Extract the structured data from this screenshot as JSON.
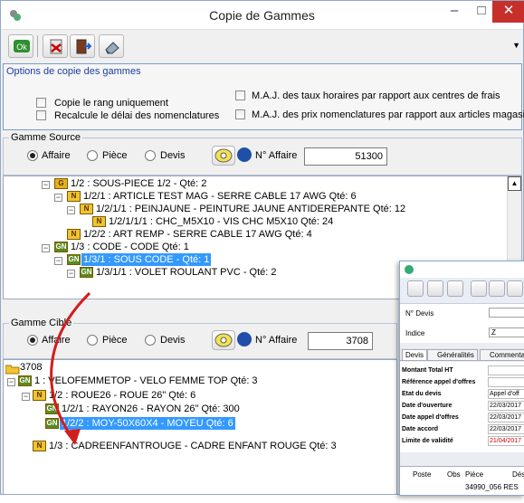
{
  "window": {
    "title": "Copie de Gammes",
    "minimize_glyph": "–",
    "maximize_glyph": "□",
    "close_glyph": "✕",
    "close_color": "#c7302a"
  },
  "toolbar": {
    "ok_label": "Ok",
    "icons": [
      "ok-icon",
      "cancel-icon",
      "exit-door-icon",
      "eraser-icon"
    ]
  },
  "options": {
    "title": "Options de copie des gammes",
    "copy_rank_label": "Copie le rang uniquement",
    "recalc_label": "Recalcule le délai des nomenclatures",
    "maj_taux_label": "M.A.J. des taux horaires par rapport aux centres de frais",
    "maj_prix_label": "M.A.J. des prix nomenclatures par rapport aux articles magasins"
  },
  "source": {
    "title": "Gamme Source",
    "radio_affaire": "Affaire",
    "radio_piece": "Pièce",
    "radio_devis": "Devis",
    "naffaire_label": "N° Affaire",
    "naffaire_value": "51300",
    "tree": [
      {
        "icon": "G",
        "text": "1/2 : SOUS-PIECE 1/2 - Qté: 2"
      },
      {
        "icon": "N",
        "text": "1/2/1 : ARTICLE TEST MAG - SERRE CABLE 17 AWG Qté: 6"
      },
      {
        "icon": "N",
        "text": "1/2/1/1 : PEINJAUNE - PEINTURE JAUNE ANTIDEREPANTE Qté: 12"
      },
      {
        "icon": "N",
        "text": "1/2/1/1/1 : CHC_M5X10 - VIS CHC M5X10 Qté: 24"
      },
      {
        "icon": "N",
        "text": "1/2/2 : ART REMP - SERRE CABLE 17 AWG Qté: 4"
      },
      {
        "icon": "GN",
        "text": "1/3 : CODE - CODE Qté: 1"
      },
      {
        "icon": "GN",
        "text": "1/3/1 : SOUS CODE - Qté: 1"
      },
      {
        "icon": "GN",
        "text": "1/3/1/1 : VOLET ROULANT PVC - Qté: 2"
      }
    ]
  },
  "cible": {
    "title": "Gamme Cible",
    "radio_affaire": "Affaire",
    "radio_piece": "Pièce",
    "radio_devis": "Devis",
    "naffaire_label": "N° Affaire",
    "naffaire_value": "3708",
    "tree": [
      {
        "icon": "folder",
        "text": "3708"
      },
      {
        "icon": "GN",
        "text": "1 : VELOFEMMETOP - VELO FEMME TOP Qté: 3"
      },
      {
        "icon": "N",
        "text": "1/2 : ROUE26 - ROUE 26\" Qté: 6"
      },
      {
        "icon": "GN",
        "text": "1/2/1 : RAYON26 - RAYON 26\" Qté: 300"
      },
      {
        "icon": "GN",
        "text": "1/2/2 : MOY-50X60X4 - MOYEU Qté: 6"
      },
      {
        "icon": "N",
        "text": "1/3 : CADREENFANTROUGE - CADRE ENFANT ROUGE Qté: 3"
      }
    ]
  },
  "bg_window": {
    "ndevis_label": "N° Devis",
    "indice_label": "Indice",
    "indice_value": "Z",
    "tabs": [
      "Devis",
      "Généralités",
      "Commentaire"
    ],
    "rows": [
      {
        "label": "Montant Total HT",
        "value": ""
      },
      {
        "label": "Référence appel d'offres",
        "value": ""
      },
      {
        "label": "Etat du devis",
        "value": "Appel d'off"
      },
      {
        "label": "Date d'ouverture",
        "value": "22/03/2017"
      },
      {
        "label": "Date appel d'offres",
        "value": "22/03/2017"
      },
      {
        "label": "Date accord",
        "value": "22/03/2017"
      },
      {
        "label": "Limite de validité",
        "value": "21/04/2017"
      }
    ],
    "footer_col1": "Poste",
    "footer_col2": "Obs",
    "footer_col3": "Pièce",
    "footer_col4": "Dés",
    "footer_row": "34990_056 RES"
  }
}
